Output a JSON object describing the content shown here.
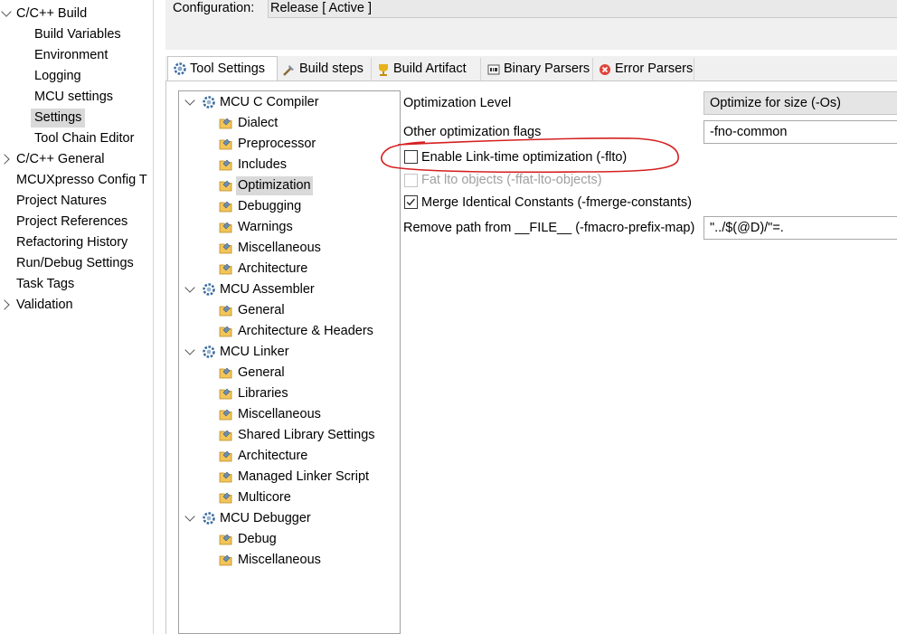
{
  "nav": {
    "items": [
      {
        "label": "C/C++ Build",
        "expander": "expanded"
      },
      {
        "label": "Build Variables"
      },
      {
        "label": "Environment"
      },
      {
        "label": "Logging"
      },
      {
        "label": "MCU settings"
      },
      {
        "label": "Settings",
        "selected": true
      },
      {
        "label": "Tool Chain Editor"
      },
      {
        "label": "C/C++ General",
        "expander": "collapsed"
      },
      {
        "label": "MCUXpresso Config T"
      },
      {
        "label": "Project Natures"
      },
      {
        "label": "Project References"
      },
      {
        "label": "Refactoring History"
      },
      {
        "label": "Run/Debug Settings"
      },
      {
        "label": "Task Tags"
      },
      {
        "label": "Validation",
        "expander": "collapsed"
      }
    ]
  },
  "config": {
    "label": "Configuration:",
    "value": "Release  [ Active ]"
  },
  "tabs": [
    {
      "label": "Tool Settings",
      "icon": "tool-settings-icon",
      "active": true
    },
    {
      "label": "Build steps",
      "icon": "build-steps-icon"
    },
    {
      "label": "Build Artifact",
      "icon": "build-artifact-icon"
    },
    {
      "label": "Binary Parsers",
      "icon": "binary-parsers-icon"
    },
    {
      "label": "Error Parsers",
      "icon": "error-parsers-icon"
    }
  ],
  "tree": {
    "groups": [
      {
        "label": "MCU C Compiler",
        "children": [
          "Dialect",
          "Preprocessor",
          "Includes",
          "Optimization",
          "Debugging",
          "Warnings",
          "Miscellaneous",
          "Architecture"
        ]
      },
      {
        "label": "MCU Assembler",
        "children": [
          "General",
          "Architecture & Headers"
        ]
      },
      {
        "label": "MCU Linker",
        "children": [
          "General",
          "Libraries",
          "Miscellaneous",
          "Shared Library Settings",
          "Architecture",
          "Managed Linker Script",
          "Multicore"
        ]
      },
      {
        "label": "MCU Debugger",
        "children": [
          "Debug",
          "Miscellaneous"
        ]
      }
    ],
    "selected": "Optimization"
  },
  "settings": {
    "optimization_level_label": "Optimization Level",
    "optimization_level_value": "Optimize for size (-Os)",
    "other_flags_label": "Other optimization flags",
    "other_flags_value": "-fno-common",
    "lto_label": "Enable Link-time optimization (-flto)",
    "lto_checked": false,
    "fat_lto_label": "Fat lto objects (-ffat-lto-objects)",
    "fat_lto_enabled": false,
    "merge_constants_label": "Merge Identical Constants (-fmerge-constants)",
    "merge_constants_checked": true,
    "remove_path_label": "Remove path from __FILE__ (-fmacro-prefix-map)",
    "remove_path_value": "\"../$(@D)/\"=."
  },
  "colors": {
    "annotation": "#d62020",
    "selection": "#d9d9d9",
    "panel": "#f0f0f0"
  }
}
